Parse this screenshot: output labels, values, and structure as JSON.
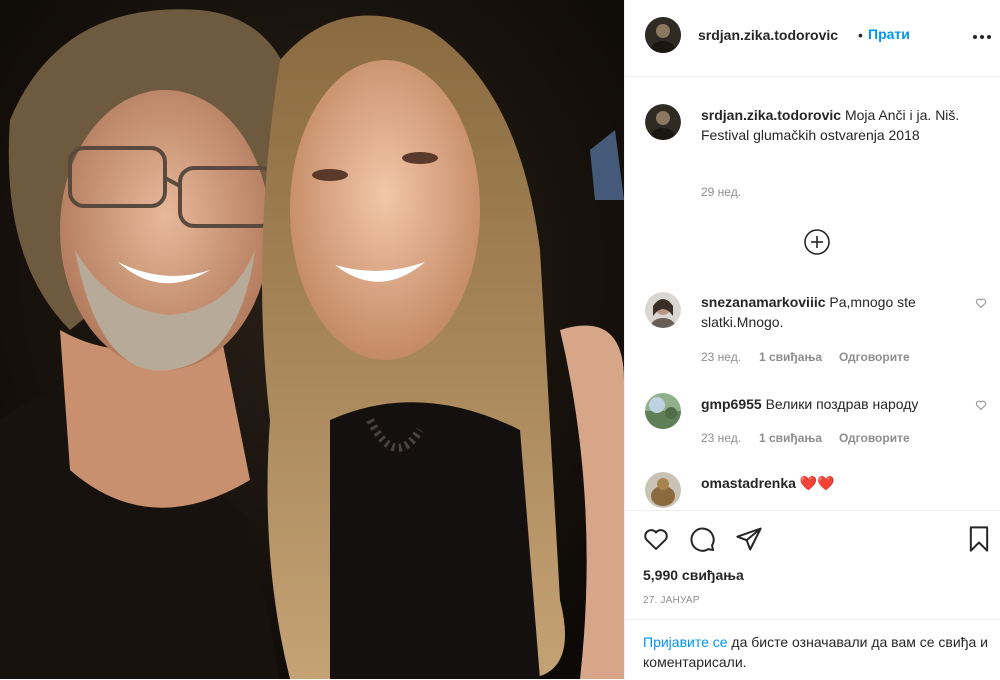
{
  "post": {
    "username": "srdjan.zika.todorovic",
    "follow_label": "Прати",
    "caption": "Moja Anči i ja. Niš. Festival glumačkih ostvarenja 2018",
    "caption_time": "29 нед."
  },
  "comments": [
    {
      "user": "snezanamarkoviiic",
      "text": "Pa,mnogo ste slatki.Mnogo.",
      "time": "23 нед.",
      "likes": "1 свиђања",
      "reply": "Одговорите"
    },
    {
      "user": "gmp6955",
      "text": "Велики поздрав народу",
      "time": "23 нед.",
      "likes": "1 свиђања",
      "reply": "Одговорите"
    },
    {
      "user": "omastadrenka",
      "text": "❤️❤️"
    }
  ],
  "likes_count": "5,990 свиђања",
  "date": "27. ЈАНУАР",
  "login_prompt": {
    "link": "Пријавите се",
    "rest": " да бисте означавали да вам се свиђа и коментарисали."
  },
  "colors": {
    "accent": "#0095f6",
    "text": "#262626",
    "muted": "#8e8e8e"
  }
}
